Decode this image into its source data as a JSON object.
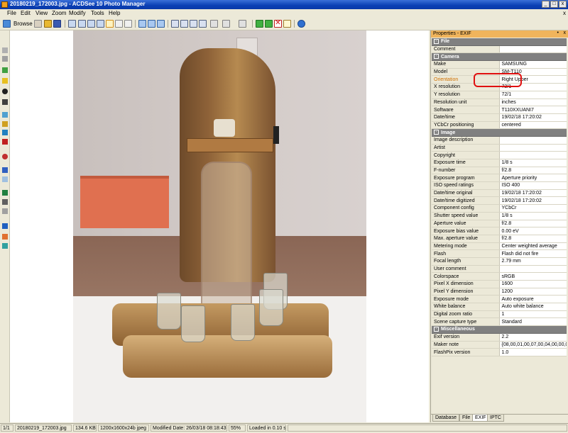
{
  "window": {
    "title": "20180219_172003.jpg - ACDSee 10 Photo Manager",
    "min_btn": "_",
    "max_btn": "□",
    "close_btn": "x"
  },
  "menu": [
    "File",
    "Edit",
    "View",
    "Zoom",
    "Modify",
    "Tools",
    "Help"
  ],
  "menu_close": "x",
  "toolbar": {
    "browse_label": "Browse"
  },
  "panel": {
    "title": "Properties - EXIF",
    "pin": "•",
    "close": "x",
    "sections": [
      {
        "name": "File",
        "rows": [
          {
            "key": "Comment",
            "value": ""
          }
        ]
      },
      {
        "name": "Camera",
        "rows": [
          {
            "key": "Make",
            "value": "SAMSUNG"
          },
          {
            "key": "Model",
            "value": "SM-T110"
          },
          {
            "key": "Orientation",
            "value": "Right Upper"
          },
          {
            "key": "X resolution",
            "value": "72/1"
          },
          {
            "key": "Y resolution",
            "value": "72/1"
          },
          {
            "key": "Resolution unit",
            "value": "inches"
          },
          {
            "key": "Software",
            "value": "T110XXUANI7"
          },
          {
            "key": "Date/time",
            "value": "19/02/18 17:20:02"
          },
          {
            "key": "YCbCr positioning",
            "value": "centered"
          }
        ]
      },
      {
        "name": "Image",
        "rows": [
          {
            "key": "Image description",
            "value": ""
          },
          {
            "key": "Artist",
            "value": ""
          },
          {
            "key": "Copyright",
            "value": ""
          },
          {
            "key": "Exposure time",
            "value": "1/8 s"
          },
          {
            "key": "F-number",
            "value": "f/2.8"
          },
          {
            "key": "Exposure program",
            "value": "Aperture priority"
          },
          {
            "key": "ISO speed ratings",
            "value": "ISO 400"
          },
          {
            "key": "Date/time original",
            "value": "19/02/18 17:20:02"
          },
          {
            "key": "Date/time digitized",
            "value": "19/02/18 17:20:02"
          },
          {
            "key": "Component config",
            "value": "YCbCr"
          },
          {
            "key": "Shutter speed value",
            "value": "1/8 s"
          },
          {
            "key": "Aperture value",
            "value": "f/2.8"
          },
          {
            "key": "Exposure bias value",
            "value": "0.00 eV"
          },
          {
            "key": "Max. aperture value",
            "value": "f/2.8"
          },
          {
            "key": "Metering mode",
            "value": "Center weighted average"
          },
          {
            "key": "Flash",
            "value": "Flash did not fire"
          },
          {
            "key": "Focal length",
            "value": "2.79 mm"
          },
          {
            "key": "User comment",
            "value": ""
          },
          {
            "key": "Colorspace",
            "value": "sRGB"
          },
          {
            "key": "Pixel X dimension",
            "value": "1600"
          },
          {
            "key": "Pixel Y dimension",
            "value": "1200"
          },
          {
            "key": "Exposure mode",
            "value": "Auto exposure"
          },
          {
            "key": "White balance",
            "value": "Auto white balance"
          },
          {
            "key": "Digital zoom ratio",
            "value": "1"
          },
          {
            "key": "Scene capture type",
            "value": "Standard"
          }
        ]
      },
      {
        "name": "Miscellaneous",
        "rows": [
          {
            "key": "Exif version",
            "value": "2.2"
          },
          {
            "key": "Maker note",
            "value": "{08,00,01,00,07,00,04,00,00,00,30,31..."
          },
          {
            "key": "FlashPix version",
            "value": "1.0"
          }
        ]
      }
    ],
    "highlight_key": "Orientation",
    "tabs": [
      "Database",
      "File",
      "EXIF",
      "IPTC"
    ],
    "active_tab": "EXIF"
  },
  "status": {
    "index": "1/1",
    "filename": "20180219_172003.jpg",
    "filesize": "134.6 KB",
    "dimensions": "1200x1600x24b jpeg",
    "modified": "Modified Date: 26/03/18 08:18:43",
    "zoom": "55%",
    "loaded": "Loaded in 0.10 s"
  },
  "colors": {
    "title_bar": "#0a3fb4",
    "panel_header": "#f0b45c",
    "section_header": "#808080",
    "annotation": "#e01010"
  }
}
